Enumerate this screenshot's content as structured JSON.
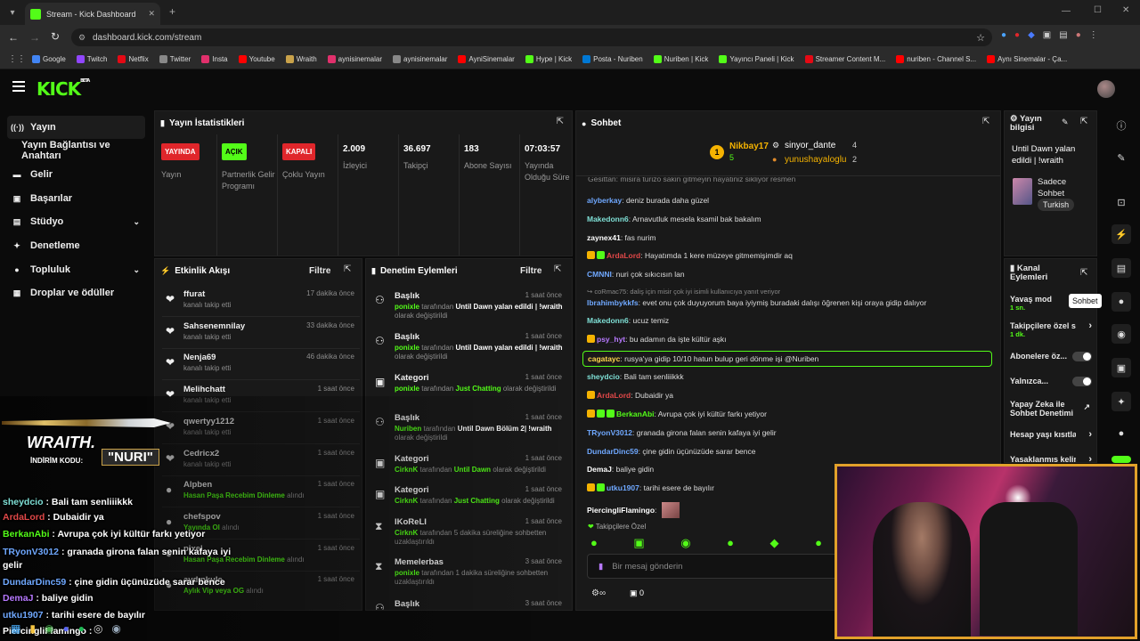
{
  "browser": {
    "tab_title": "Stream - Kick Dashboard",
    "url": "dashboard.kick.com/stream",
    "new_tab": "+",
    "bookmarks": [
      {
        "label": "Google",
        "color": "#4285f4"
      },
      {
        "label": "Twitch",
        "color": "#9146ff"
      },
      {
        "label": "Netflix",
        "color": "#e50914"
      },
      {
        "label": "Twitter",
        "color": "#888888"
      },
      {
        "label": "Insta",
        "color": "#e1306c"
      },
      {
        "label": "Youtube",
        "color": "#ff0000"
      },
      {
        "label": "Wraith",
        "color": "#c9a24a"
      },
      {
        "label": "aynisinemalar",
        "color": "#e1306c"
      },
      {
        "label": "aynisinemalar",
        "color": "#888888"
      },
      {
        "label": "AyniSinemalar",
        "color": "#ff0000"
      },
      {
        "label": "Hype | Kick",
        "color": "#53fc18"
      },
      {
        "label": "Posta - Nuriben",
        "color": "#0078d4"
      },
      {
        "label": "Nuriben | Kick",
        "color": "#53fc18"
      },
      {
        "label": "Yayıncı Paneli | Kick",
        "color": "#53fc18"
      },
      {
        "label": "Streamer Content M...",
        "color": "#e50914"
      },
      {
        "label": "nuriben - Channel S...",
        "color": "#ff0000"
      },
      {
        "label": "Aynı Sinemalar - Ça...",
        "color": "#ff0000"
      }
    ]
  },
  "brand": {
    "logo": "KICK",
    "beta": "BETA"
  },
  "sidebar": {
    "items": [
      {
        "label": "Yayın",
        "icon": "broadcast-icon"
      },
      {
        "label": "Yayın Bağlantısı ve Anahtarı",
        "icon": ""
      },
      {
        "label": "Gelir",
        "icon": "wallet-icon"
      },
      {
        "label": "Başarılar",
        "icon": "trophy-icon"
      },
      {
        "label": "Stüdyo",
        "icon": "studio-icon"
      },
      {
        "label": "Denetleme",
        "icon": "wrench-icon"
      },
      {
        "label": "Topluluk",
        "icon": "community-icon"
      },
      {
        "label": "Droplar ve ödüller",
        "icon": "gift-icon"
      }
    ]
  },
  "stats": {
    "title": "Yayın İstatistikleri",
    "items": [
      {
        "badge": "YAYINDA",
        "badge_color": "#e0262b",
        "label": "Yayın"
      },
      {
        "badge": "AÇIK",
        "badge_color": "#53fc18",
        "label": "Partnerlik Gelir Programı"
      },
      {
        "badge": "KAPALI",
        "badge_color": "#e0262b",
        "label": "Çoklu Yayın"
      },
      {
        "value": "2.009",
        "label": "İzleyici"
      },
      {
        "value": "36.697",
        "label": "Takipçi"
      },
      {
        "value": "183",
        "label": "Abone Sayısı"
      },
      {
        "value": "07:03:57",
        "label": "Yayında Olduğu Süre"
      }
    ]
  },
  "activity": {
    "title": "Etkinlik Akışı",
    "filter": "Filtre",
    "rows": [
      {
        "name": "ffurat",
        "sub": "kanalı takip etti",
        "time": "17 dakika önce",
        "icon": "heart-icon"
      },
      {
        "name": "Sahsenemnilay",
        "sub": "kanalı takip etti",
        "time": "33 dakika önce",
        "icon": "heart-icon"
      },
      {
        "name": "Nenja69",
        "sub": "kanalı takip etti",
        "time": "46 dakika önce",
        "icon": "heart-icon"
      },
      {
        "name": "Melihchatt",
        "sub": "kanalı takip etti",
        "time": "1 saat önce",
        "icon": "heart-icon"
      },
      {
        "name": "qwertyy1212",
        "sub": "kanalı takip etti",
        "time": "1 saat önce",
        "icon": "heart-icon"
      },
      {
        "name": "Cedricx2",
        "sub": "kanalı takip etti",
        "time": "1 saat önce",
        "icon": "heart-icon"
      },
      {
        "name": "Alpben",
        "sub_green": "Hasan Paşa Recebim Dinleme",
        "sub": "alındı",
        "time": "1 saat önce",
        "icon": "reward-icon"
      },
      {
        "name": "chefspov",
        "sub_green": "Yayında Ol",
        "sub": "alındı",
        "time": "1 saat önce",
        "icon": "reward-icon"
      },
      {
        "name": "pixel",
        "sub_green": "Hasan Paşa Recebim Dinleme",
        "sub": "alındı",
        "time": "1 saat önce",
        "icon": "reward-icon"
      },
      {
        "name": "aydınkule",
        "sub_green": "Aylık Vip veya OG",
        "sub": "alındı",
        "time": "1 saat önce",
        "icon": "reward-icon"
      }
    ]
  },
  "modlog": {
    "title": "Denetim Eylemleri",
    "filter": "Filtre",
    "rows": [
      {
        "title": "Başlık",
        "actor": "ponixle",
        "text": "tarafından",
        "val": "Until Dawn yalan edildi | !wraith",
        "tail": "olarak değiştirildi",
        "time": "1 saat önce",
        "icon": "user-edit-icon"
      },
      {
        "title": "Başlık",
        "actor": "ponixle",
        "text": "tarafından",
        "val": "Until Dawn yalan edildi | !wraith",
        "tail": "olarak değiştirildi",
        "time": "1 saat önce",
        "icon": "user-edit-icon"
      },
      {
        "title": "Kategori",
        "actor": "ponixle",
        "text": "tarafından",
        "val": "Just Chatting",
        "tail": "olarak değiştirildi",
        "time": "1 saat önce",
        "icon": "category-icon"
      },
      {
        "title": "Başlık",
        "actor": "Nuriben",
        "text": "tarafından",
        "val": "Until Dawn Bölüm 2| !wraith",
        "tail": "olarak değiştirildi",
        "time": "1 saat önce",
        "icon": "user-edit-icon"
      },
      {
        "title": "Kategori",
        "actor": "CirknK",
        "text": "tarafından",
        "val": "Until Dawn",
        "tail": "olarak değiştirildi",
        "time": "1 saat önce",
        "icon": "category-icon"
      },
      {
        "title": "Kategori",
        "actor": "CirknK",
        "text": "tarafından",
        "val": "Just Chatting",
        "tail": "olarak değiştirildi",
        "time": "1 saat önce",
        "icon": "category-icon"
      },
      {
        "title": "IKoReLI",
        "actor": "CirknK",
        "text": "tarafından 5 dakika süreliğine sohbetten uzaklaştırıldı",
        "val": "",
        "tail": "",
        "time": "1 saat önce",
        "icon": "hourglass-icon"
      },
      {
        "title": "Memelerbas",
        "actor": "ponixle",
        "text": "tarafından 1 dakika süreliğine sohbetten uzaklaştırıldı",
        "val": "",
        "tail": "",
        "time": "3 saat önce",
        "icon": "hourglass-icon"
      },
      {
        "title": "Başlık",
        "actor": "",
        "text": "",
        "val": "",
        "tail": "",
        "time": "3 saat önce",
        "icon": "user-edit-icon"
      }
    ]
  },
  "chat": {
    "title": "Sohbet",
    "leaders": [
      {
        "name": "Nikbay17",
        "count": "5",
        "rank": "1"
      },
      {
        "name": "sinyor_dante",
        "count": "4"
      },
      {
        "name": "yunushayaloglu",
        "count": "2"
      }
    ],
    "pinned_cut": "Gesittan: misira turizo sakin gitmeyin hayatiniz sikliyor resmen",
    "messages": [
      {
        "user": "alyberkay",
        "color": "#6fa8ff",
        "text": "deniz burada daha güzel"
      },
      {
        "user": "Makedonn6",
        "color": "#7fe0d6",
        "text": "Arnavutluk mesela ksamil bak bakalım"
      },
      {
        "user": "zaynex41",
        "color": "#ffffff",
        "text": "fas nurim"
      },
      {
        "user": "ArdaLord",
        "color": "#e04848",
        "text": "Hayatımda 1 kere müzeye gitmemişimdir aq",
        "badges": 2
      },
      {
        "user": "CMNNI",
        "color": "#6fa8ff",
        "text": "nuri çok sıkıcısın lan"
      },
      {
        "reply": "coRmac75: daliş için misir çok iyi isimli kullanıcıya yanıt veriyor"
      },
      {
        "user": "Ibrahimbykkfs",
        "color": "#6fa8ff",
        "text": "evet onu çok duyuyorum baya iyiymiş buradaki dalışı öğrenen kişi oraya gidip dalıyor"
      },
      {
        "user": "Makedonn6",
        "color": "#7fe0d6",
        "text": "ucuz temiz"
      },
      {
        "user": "psy_hyt",
        "color": "#b779ff",
        "text": "bu adamın da işte kültür aşkı",
        "badges": 1
      },
      {
        "user": "cagatayc",
        "color": "#ffd84d",
        "text": "rusya'ya gidip 10/10 hatun bulup geri dönme işi @Nuriben",
        "highlight": true
      },
      {
        "user": "sheydcio",
        "color": "#7fe0d6",
        "text": "Bali tam senliiikkk"
      },
      {
        "user": "ArdaLord",
        "color": "#e04848",
        "text": "Dubaidir ya",
        "badges": 1
      },
      {
        "user": "BerkanAbi",
        "color": "#53fc18",
        "text": "Avrupa çok iyi kültür farkı yetiyor",
        "badges": 3
      },
      {
        "user": "TRyonV3012",
        "color": "#6fa8ff",
        "text": "granada girona falan senin kafaya iyi gelir"
      },
      {
        "user": "DundarDinc59",
        "color": "#6fa8ff",
        "text": "çine gidin üçünüzüde sarar bence"
      },
      {
        "user": "DemaJ",
        "color": "#ffffff",
        "text": "baliye gidin"
      },
      {
        "user": "utku1907",
        "color": "#6fa8ff",
        "text": "tarihi esere de bayılır",
        "badges": 2
      },
      {
        "user": "PiercingliFlamingo",
        "color": "#ffffff",
        "text": ""
      }
    ],
    "followers_only": "Takipçilere Özel",
    "input_placeholder": "Bir mesaj gönderin",
    "viewers_count": "0"
  },
  "stream_info": {
    "title": "Yayın bilgisi",
    "stream_title": "Until Dawn yalan edildi | !wraith",
    "category": "Sadece Sohbet",
    "language": "Turkish"
  },
  "channel_actions": {
    "title": "Kanal Eylemleri",
    "tooltip": "Sohbet",
    "items": [
      {
        "label": "Yavaş mod",
        "sub": "1 sn."
      },
      {
        "label": "Takipçilere özel s...",
        "sub": "1 dk."
      },
      {
        "label": "Abonelere öz..."
      },
      {
        "label": "Yalnızca..."
      },
      {
        "label": "Yapay Zeka ile Sohbet Denetimi"
      },
      {
        "label": "Hesap yaşı kısıtla"
      },
      {
        "label": "Yasaklanmış kelim..."
      }
    ]
  },
  "overlay": {
    "sponsor": "WRAITH.",
    "code_label": "İNDİRİM KODU:",
    "code": "NURI",
    "lines": [
      {
        "user": "sheydcio",
        "color": "#7fe0d6",
        "text": "Bali tam senliiikkk"
      },
      {
        "user": "ArdaLord",
        "color": "#e04848",
        "text": "Dubaidir ya"
      },
      {
        "user": "BerkanAbi",
        "color": "#53fc18",
        "text": "Avrupa çok iyi kültür farkı yetiyor"
      },
      {
        "user": "TRyonV3012",
        "color": "#6fa8ff",
        "text": "granada girona falan senin kafaya iyi gelir"
      },
      {
        "user": "DundarDinc59",
        "color": "#6fa8ff",
        "text": "çine gidin üçünüzüde sarar bence"
      },
      {
        "user": "DemaJ",
        "color": "#b779ff",
        "text": "baliye gidin"
      },
      {
        "user": "utku1907",
        "color": "#6fa8ff",
        "text": "tarihi esere de bayılır"
      },
      {
        "user": "PiercingliFlamingo",
        "color": "#ffffff",
        "text": ""
      }
    ]
  },
  "colors": {
    "accent": "#53fc18",
    "panel": "#191919",
    "bg": "#0b0b0b",
    "live": "#e0262b"
  }
}
